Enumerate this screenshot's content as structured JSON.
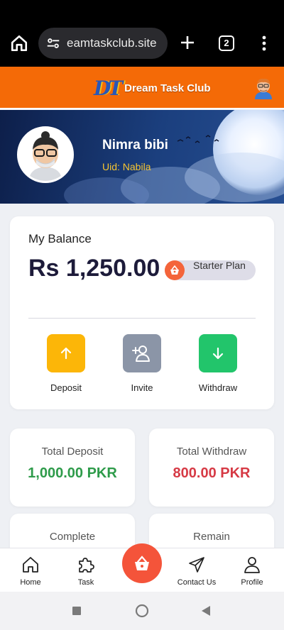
{
  "browser": {
    "url": "eamtaskclub.site",
    "tab_count": "2"
  },
  "app": {
    "logo_mark": "DT",
    "logo_text": "Dream Task Club",
    "brand_color": "#f46a07"
  },
  "profile": {
    "name": "Nimra bibi",
    "uid": "Uid: Nabila"
  },
  "balance": {
    "title": "My Balance",
    "amount": "Rs 1,250.00",
    "plan": "Starter Plan",
    "actions": [
      {
        "label": "Deposit",
        "icon": "arrow-up-icon",
        "color": "#fcb608"
      },
      {
        "label": "Invite",
        "icon": "add-user-icon",
        "color": "#8b95a7"
      },
      {
        "label": "Withdraw",
        "icon": "arrow-down-icon",
        "color": "#22c56b"
      }
    ]
  },
  "stats": [
    {
      "label": "Total Deposit",
      "value": "1,000.00 PKR",
      "color": "#2e9b4a"
    },
    {
      "label": "Total Withdraw",
      "value": "800.00 PKR",
      "color": "#d63a45"
    },
    {
      "label": "Complete",
      "value": ""
    },
    {
      "label": "Remain",
      "value": ""
    }
  ],
  "nav": [
    {
      "label": "Home",
      "icon": "home-icon"
    },
    {
      "label": "Task",
      "icon": "puzzle-icon"
    },
    {
      "label": "",
      "icon": "basket-icon"
    },
    {
      "label": "Contact Us",
      "icon": "send-icon"
    },
    {
      "label": "Profile",
      "icon": "user-icon"
    }
  ]
}
